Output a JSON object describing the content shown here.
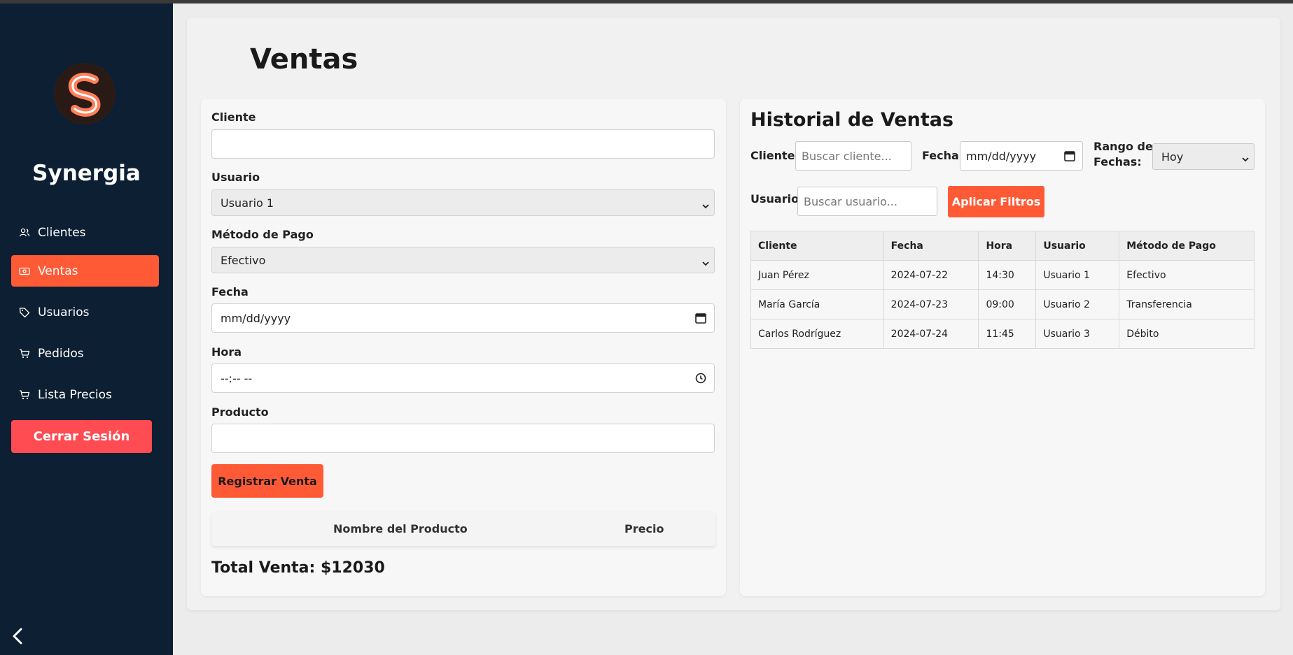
{
  "sidebar": {
    "brand": "Synergia",
    "items": [
      {
        "label": "Clientes",
        "icon": "users-icon"
      },
      {
        "label": "Ventas",
        "icon": "money-icon",
        "active": true
      },
      {
        "label": "Usuarios",
        "icon": "tag-icon"
      },
      {
        "label": "Pedidos",
        "icon": "cart-icon"
      },
      {
        "label": "Lista Precios",
        "icon": "cart-icon"
      }
    ],
    "logout_label": "Cerrar Sesión"
  },
  "page": {
    "title": "Ventas"
  },
  "form": {
    "cliente_label": "Cliente",
    "cliente_value": "",
    "usuario_label": "Usuario",
    "usuario_value": "Usuario 1",
    "metodo_label": "Método de Pago",
    "metodo_value": "Efectivo",
    "fecha_label": "Fecha",
    "fecha_value": "mm/dd/yyyy",
    "hora_label": "Hora",
    "hora_value": "--:-- --",
    "producto_label": "Producto",
    "producto_value": "",
    "register_label": "Registrar Venta",
    "products_header": {
      "name": "Nombre del Producto",
      "price": "Precio"
    },
    "total_label": "Total Venta: $12030"
  },
  "history": {
    "title": "Historial de Ventas",
    "filters": {
      "cliente_label": "Cliente:",
      "cliente_placeholder": "Buscar cliente...",
      "fecha_label": "Fecha:",
      "fecha_value": "mm/dd/yyyy",
      "rango_label_1": "Rango de",
      "rango_label_2": "Fechas:",
      "rango_value": "Hoy",
      "usuario_label": "Usuario:",
      "usuario_placeholder": "Buscar usuario...",
      "apply_label": "Aplicar Filtros"
    },
    "columns": [
      "Cliente",
      "Fecha",
      "Hora",
      "Usuario",
      "Método de Pago"
    ],
    "rows": [
      [
        "Juan Pérez",
        "2024-07-22",
        "14:30",
        "Usuario 1",
        "Efectivo"
      ],
      [
        "María García",
        "2024-07-23",
        "09:00",
        "Usuario 2",
        "Transferencia"
      ],
      [
        "Carlos Rodríguez",
        "2024-07-24",
        "11:45",
        "Usuario 3",
        "Débito"
      ]
    ]
  },
  "colors": {
    "sidebar_bg": "#0d1f33",
    "accent": "#ff5a36",
    "logout": "#ff4b52"
  }
}
